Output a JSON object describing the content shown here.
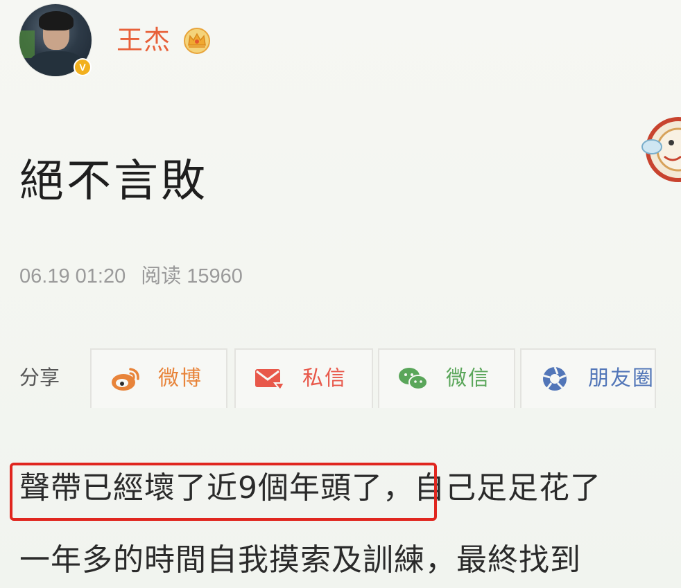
{
  "author": {
    "name": "王杰",
    "verified_badge": "V",
    "avatar_icon": "avatar",
    "badge_icon": "crown-icon",
    "name_color": "#e8613a"
  },
  "post": {
    "title": "絕不言敗",
    "date": "06.19 01:20",
    "read_label": "阅读 15960"
  },
  "share": {
    "label": "分享",
    "items": [
      {
        "label": "微博",
        "icon": "weibo-icon",
        "color": "#e8843a"
      },
      {
        "label": "私信",
        "icon": "envelope-icon",
        "color": "#e8584a"
      },
      {
        "label": "微信",
        "icon": "wechat-icon",
        "color": "#5aa65a"
      },
      {
        "label": "朋友圈",
        "icon": "moments-icon",
        "color": "#5276b8"
      }
    ]
  },
  "body": {
    "line1_highlighted": "聲帶已經壞了近9個年頭了",
    "line1_rest": "，自己足足花了",
    "line2": "一年多的時間自我摸索及訓練，最終找到"
  },
  "highlight_color": "#e0261f"
}
